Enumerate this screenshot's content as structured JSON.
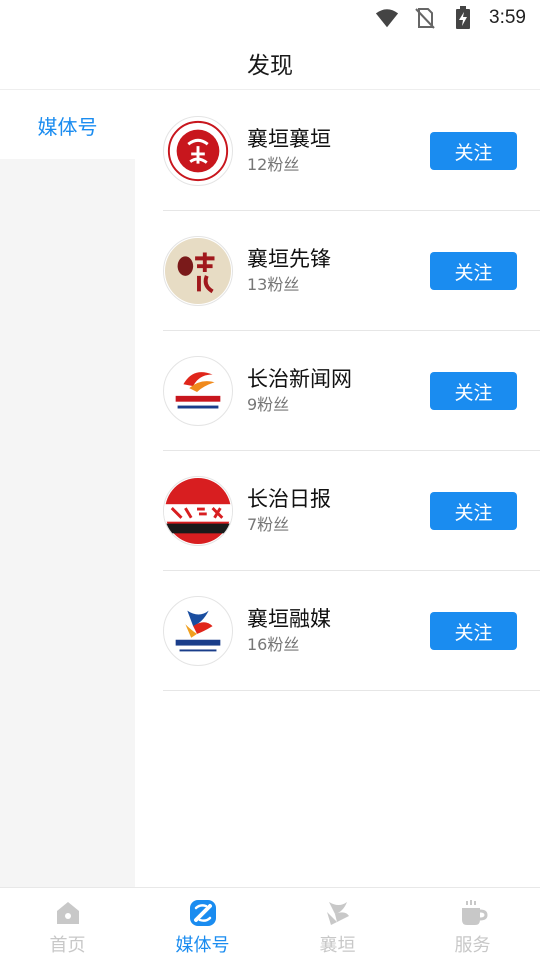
{
  "status_bar": {
    "time": "3:59"
  },
  "header": {
    "title": "发现"
  },
  "sidebar": {
    "items": [
      {
        "label": "媒体号",
        "active": true
      }
    ]
  },
  "media": [
    {
      "name": "襄垣襄垣",
      "fans": "12粉丝",
      "follow_label": "关注",
      "avatar_icon": "red-seal-logo-icon"
    },
    {
      "name": "襄垣先锋",
      "fans": "13粉丝",
      "follow_label": "关注",
      "avatar_icon": "calligraphy-logo-icon"
    },
    {
      "name": "长治新闻网",
      "fans": "9粉丝",
      "follow_label": "关注",
      "avatar_icon": "changzhi-news-logo-icon"
    },
    {
      "name": "长治日报",
      "fans": "7粉丝",
      "follow_label": "关注",
      "avatar_icon": "changzhi-daily-logo-icon"
    },
    {
      "name": "襄垣融媒",
      "fans": "16粉丝",
      "follow_label": "关注",
      "avatar_icon": "xiangyuan-media-logo-icon"
    }
  ],
  "tabbar": {
    "tabs": [
      {
        "label": "首页",
        "icon": "home-icon"
      },
      {
        "label": "媒体号",
        "icon": "media-icon",
        "active": true
      },
      {
        "label": "襄垣",
        "icon": "xiangyuan-icon"
      },
      {
        "label": "服务",
        "icon": "service-cup-icon"
      }
    ]
  },
  "colors": {
    "accent": "#1a8cf0",
    "inactive": "#c8c8c8",
    "sidebar_bg": "#f5f5f5"
  }
}
